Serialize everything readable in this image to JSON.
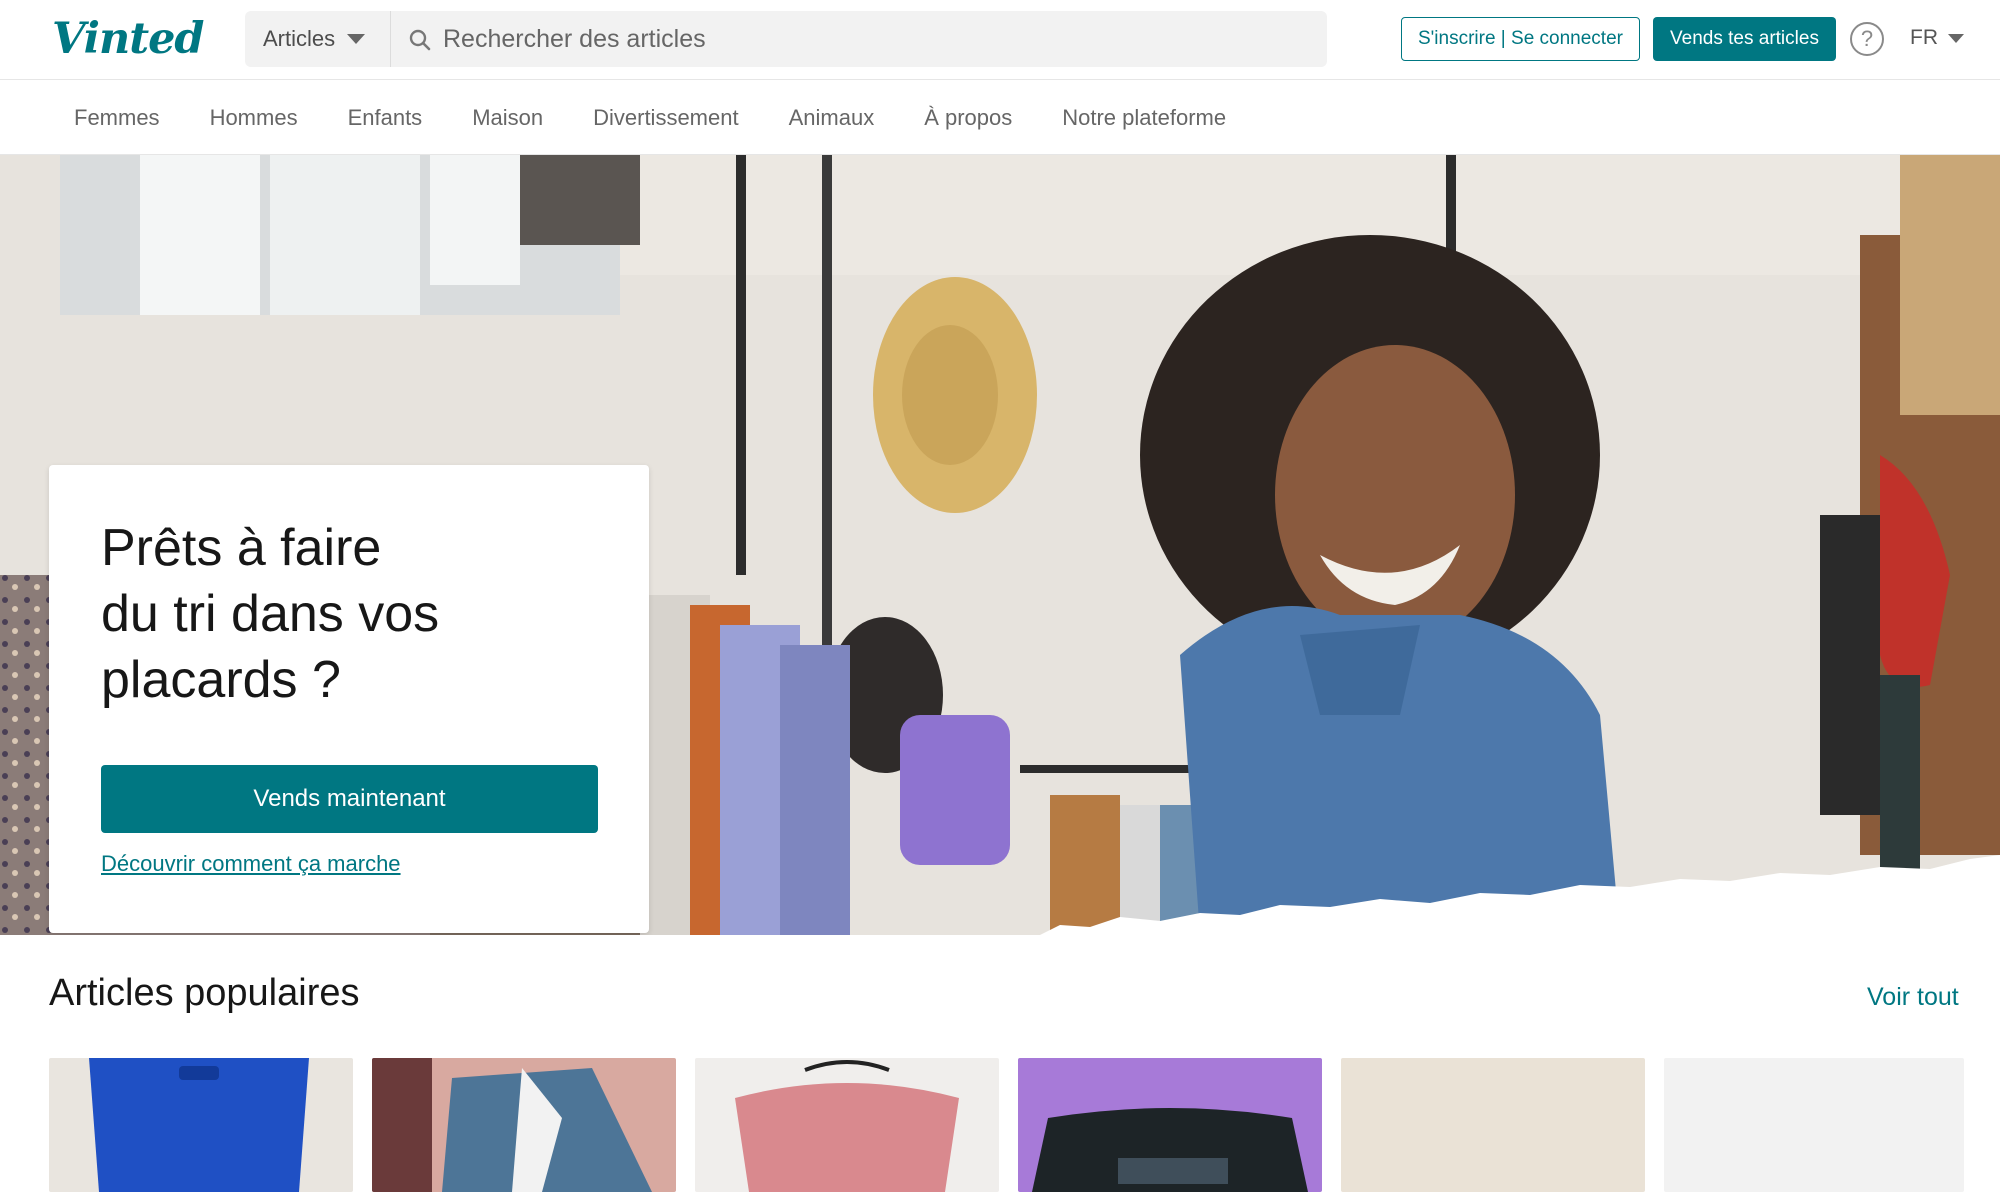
{
  "header": {
    "logo": "Vinted",
    "category_select": "Articles",
    "search_placeholder": "Rechercher des articles",
    "login_label": "S'inscrire | Se connecter",
    "sell_label": "Vends tes articles",
    "help_icon": "?",
    "language": "FR"
  },
  "nav": {
    "items": [
      "Femmes",
      "Hommes",
      "Enfants",
      "Maison",
      "Divertissement",
      "Animaux",
      "À propos",
      "Notre plateforme"
    ]
  },
  "hero": {
    "title_line1": "Prêts à faire",
    "title_line2": "du tri dans vos",
    "title_line3": "placards ?",
    "cta_label": "Vends maintenant",
    "link_label": "Découvrir comment ça marche"
  },
  "popular": {
    "title": "Articles populaires",
    "see_all": "Voir tout"
  },
  "colors": {
    "brand": "#007782"
  }
}
